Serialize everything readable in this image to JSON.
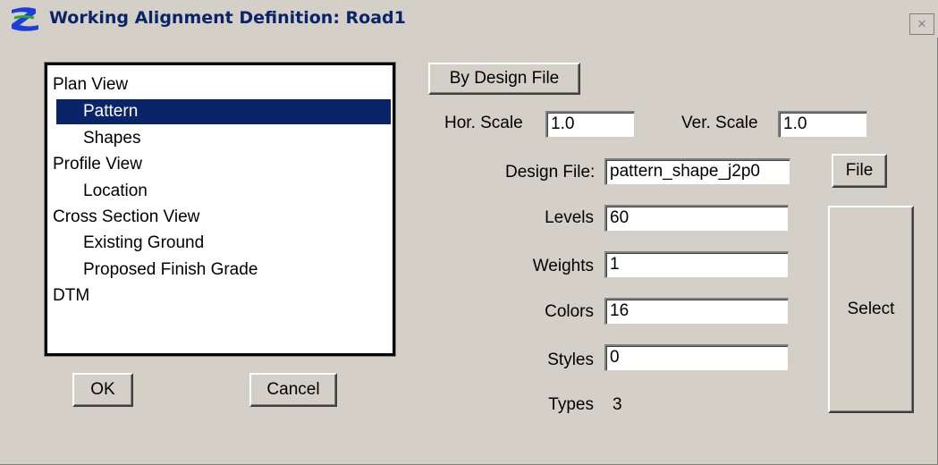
{
  "window": {
    "title": "Working Alignment Definition: Road1",
    "close_glyph": "×"
  },
  "tree": {
    "items": [
      {
        "label": "Plan View",
        "level": 0,
        "selected": false
      },
      {
        "label": "Pattern",
        "level": 1,
        "selected": true
      },
      {
        "label": "Shapes",
        "level": 1,
        "selected": false
      },
      {
        "label": "Profile View",
        "level": 0,
        "selected": false
      },
      {
        "label": "Location",
        "level": 1,
        "selected": false
      },
      {
        "label": "Cross Section View",
        "level": 0,
        "selected": false
      },
      {
        "label": "Existing Ground",
        "level": 1,
        "selected": false
      },
      {
        "label": "Proposed Finish Grade",
        "level": 1,
        "selected": false
      },
      {
        "label": "DTM",
        "level": 0,
        "selected": false
      }
    ]
  },
  "buttons": {
    "by_design_file": "By Design File",
    "file": "File",
    "select": "Select",
    "ok": "OK",
    "cancel": "Cancel"
  },
  "scale": {
    "hor_label": "Hor. Scale",
    "hor_value": "1.0",
    "ver_label": "Ver. Scale",
    "ver_value": "1.0"
  },
  "design_file": {
    "label": "Design File:",
    "value": "pattern_shape_j2p0"
  },
  "symbology": {
    "levels_label": "Levels",
    "levels_value": "60",
    "weights_label": "Weights",
    "weights_value": "1",
    "colors_label": "Colors",
    "colors_value": "16",
    "styles_label": "Styles",
    "styles_value": "0",
    "types_label": "Types",
    "types_value": "3"
  },
  "colors": {
    "dialog_bg": "#d4d0c8",
    "selection": "#0a246a",
    "title_text": "#0a246a",
    "icon_blue": "#1c3fd8",
    "icon_green": "#2fa33a"
  },
  "icons": {
    "app": "bentley-b-logo-icon",
    "close": "close-icon"
  }
}
